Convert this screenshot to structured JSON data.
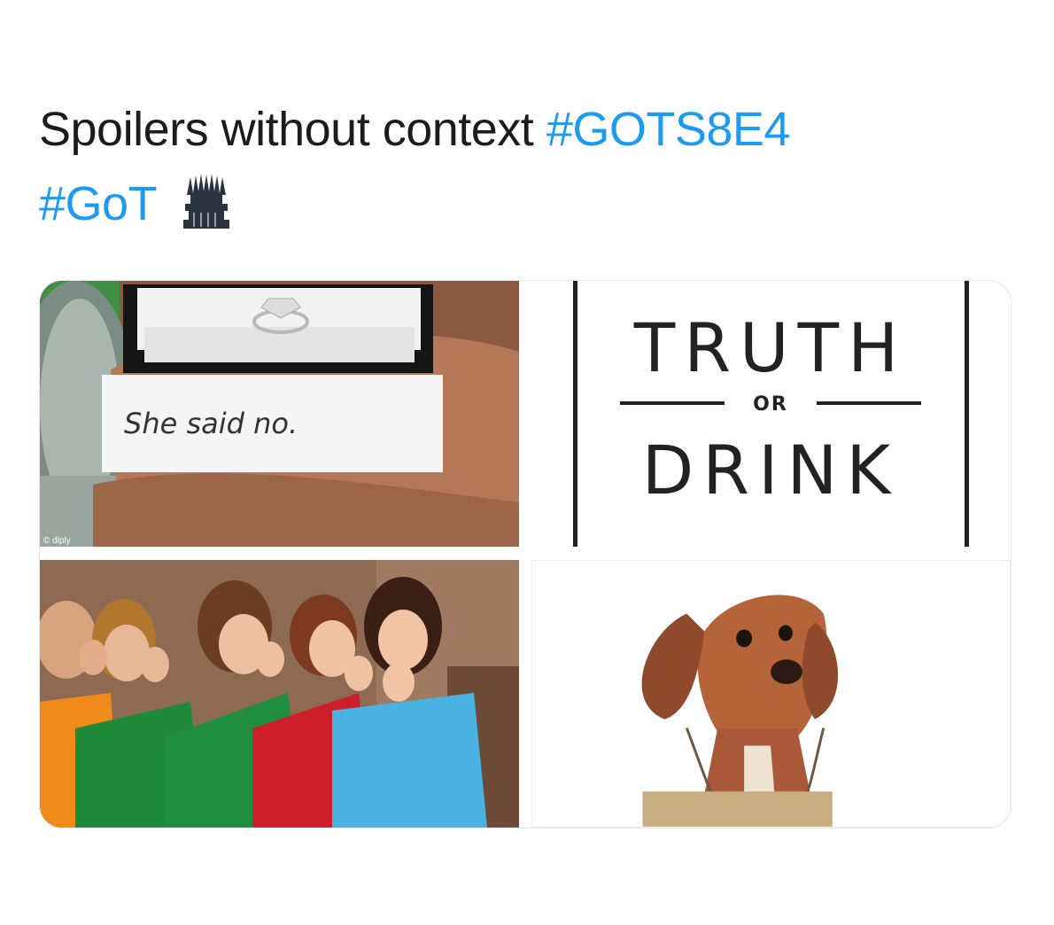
{
  "tweet": {
    "text_plain": "Spoilers without context",
    "hashtag_1": "#GOTS8E4",
    "hashtag_2": "#GoT",
    "emoji": "throne-icon"
  },
  "colors": {
    "text": "#1c1c1c",
    "hashtag": "#1d9bf0"
  },
  "media": {
    "top_left": {
      "note_text": "She said no.",
      "watermark": "© diply"
    },
    "top_right": {
      "word_1": "TRUTH",
      "word_or": "OR",
      "word_2": "DRINK"
    },
    "bottom_left": {},
    "bottom_right": {}
  }
}
